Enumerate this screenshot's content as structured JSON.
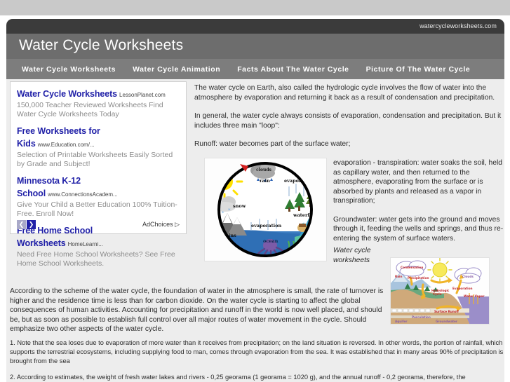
{
  "header": {
    "domain": "watercycleworksheets.com",
    "title": "Water Cycle Worksheets",
    "nav": [
      {
        "label": "Water Cycle Worksheets"
      },
      {
        "label": "Water Cycle Animation"
      },
      {
        "label": "Facts About The Water Cycle"
      },
      {
        "label": "Picture Of The Water Cycle"
      }
    ]
  },
  "ads": {
    "items": [
      {
        "title": "Water Cycle Worksheets",
        "url": "LessonPlanet.com",
        "desc": "150,000 Teacher Reviewed Worksheets Find Water Cycle Worksheets Today"
      },
      {
        "title": "Free Worksheets for Kids",
        "url": "www.Education.com/...",
        "desc": "Selection of Printable Worksheets Easily Sorted by Grade and Subject!"
      },
      {
        "title": "Minnesota K-12 School",
        "url": "www.ConnectionsAcadem...",
        "desc": "Give Your Child a Better Education 100% Tuition-Free. Enroll Now!"
      },
      {
        "title": "Free Home School Worksheets",
        "url": "HomeLearni...",
        "desc": "Need Free Home School Worksheets? See Free Home School Worksheets."
      }
    ],
    "prev_arrow": "❮",
    "next_arrow": "❯",
    "adchoices_label": "AdChoices ▷"
  },
  "main": {
    "intro_1": "The water cycle on Earth, also called the hydrologic cycle involves the flow of water into the atmosphere by evaporation and returning it back as a result of condensation and precipitation.",
    "intro_2": "In general, the water cycle always consists of evaporation, condensation and precipitation. But it includes three main \"loop\":",
    "intro_3": "Runoff: water becomes part of the surface water;",
    "side_1": "evaporation - transpiration: water soaks the soil, held as capillary water, and then returned to the atmosphere, evaporating from the surface or is absorbed by plants and released as a vapor in transpiration;",
    "side_2": "Groundwater: water gets into the ground and moves through it, feeding the wells and springs, and thus re-entering the system of surface waters.",
    "image_caption": "Water cycle worksheets",
    "body_1": "According to the scheme of the water cycle, the foundation of water in the atmosphere is small, the rate of turnover is higher and the residence time is less than for carbon dioxide. On the water cycle is starting to affect the global consequences of human activities. Accounting for precipitation and runoff in the world is now well placed, and should be, but as soon as possible to establish full control over all major routes of water movement in the cycle. Should emphasize two other aspects of the water cycle.",
    "body_2": "1. Note that the sea loses due to evaporation of more water than it receives from precipitation; on the land situation is reversed. In other words, the portion of rainfall, which supports the terrestrial ecosystems, including supplying food to man, comes through evaporation from the sea. It was established that in many areas 90% of precipitation is brought from the sea",
    "body_3": "2. According to estimates, the weight of fresh water lakes and rivers - 0,25 georama (1 georama = 1020 g), and the annual runoff - 0,2 georama, therefore, the"
  },
  "cycle_diagram": {
    "labels": [
      "clouds",
      "rain",
      "evaporation",
      "sun",
      "snow",
      "mountains",
      "evaporation",
      "ocean",
      "waterfall"
    ]
  },
  "hydrologic_diagram": {
    "labels": [
      "Condensation",
      "Rain",
      "Precipitation",
      "Clouds",
      "Hydrologic Cycle",
      "Evaporation",
      "Water Vapor",
      "Surface Runoff",
      "Percolation",
      "Aquifer",
      "Groundwater"
    ]
  },
  "colors": {
    "page_bg": "#ffffff",
    "top_strip": "#c9c9c9",
    "header_dark": "#3b3b3b",
    "header_mid": "#6d6d6d",
    "nav_bar": "#7d7d7d",
    "content_bg": "#ededed",
    "ad_link": "#2121a8",
    "ad_desc": "#8c8c8c",
    "text": "#2b2b2b"
  }
}
